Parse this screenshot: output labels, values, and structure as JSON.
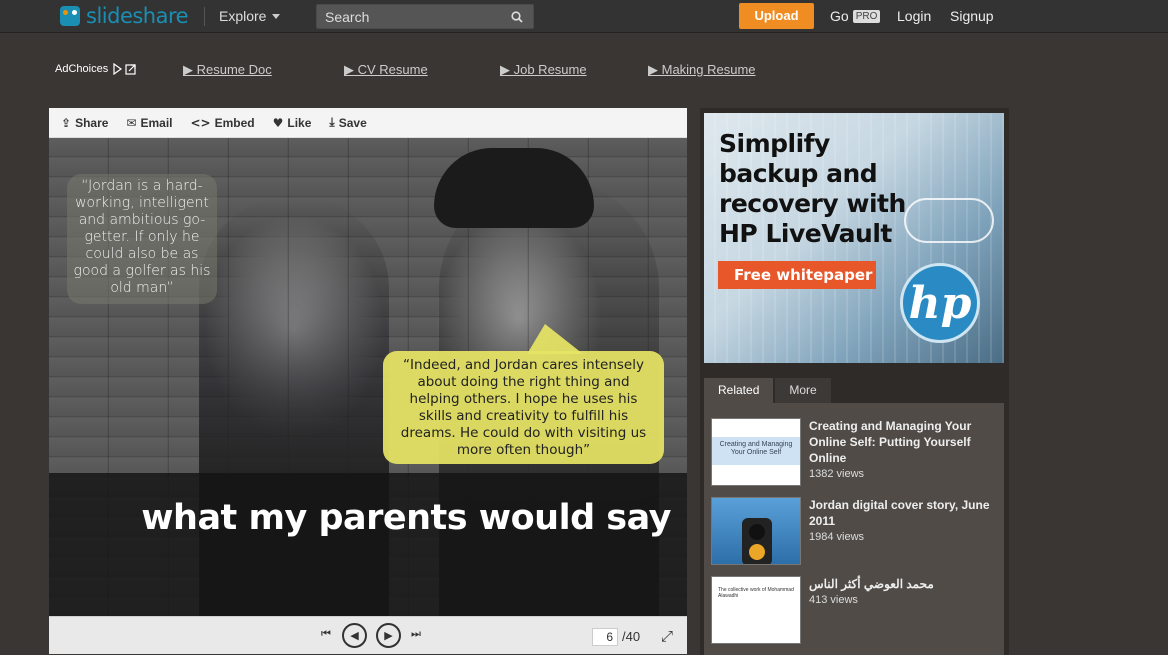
{
  "header": {
    "logo_text": "slideshare",
    "explore_label": "Explore",
    "search_placeholder": "Search",
    "upload_label": "Upload",
    "go_label": "Go",
    "pro_badge": "PRO",
    "login_label": "Login",
    "signup_label": "Signup"
  },
  "ads_row": {
    "adchoices_label": "AdChoices",
    "links": [
      "▶ Resume Doc",
      "▶ CV Resume",
      "▶ Job Resume",
      "▶ Making Resume"
    ]
  },
  "viewer": {
    "toolbar": {
      "share": "Share",
      "email": "Email",
      "embed": "Embed",
      "like": "Like",
      "save": "Save"
    },
    "slide": {
      "quote_left": "“Jordan is a hard-working, intelligent and ambitious go-getter. If only he could also be as good a golfer as his old man”",
      "quote_right": "“Indeed, and Jordan cares intensely about doing the right thing and helping others. I hope he uses his skills and creativity to fulfill his dreams. He could do with visiting us more often though”",
      "caption": "what my parents would say"
    },
    "controls": {
      "current_page": "6",
      "total_pages": "/40"
    }
  },
  "sidebar": {
    "ad": {
      "headline": "Simplify backup and recovery with HP LiveVault",
      "cta": "Free whitepaper",
      "brand": "hp"
    },
    "tabs": [
      "Related",
      "More"
    ],
    "related": [
      {
        "title": "Creating and Managing Your Online Self: Putting Yourself Online",
        "views": "1382 views",
        "thumb_text": "Creating and Managing Your Online Self"
      },
      {
        "title": "Jordan digital cover story, June 2011",
        "views": "1984 views"
      },
      {
        "title": "محمد العوضي أكثر الناس",
        "views": "413 views",
        "thumb_text": "The collective work of Mohammad Alawadhi"
      }
    ]
  },
  "colors": {
    "brand_blue": "#1a8fb3",
    "upload_orange": "#f08d22",
    "bubble_yellow": "#e6e464",
    "ad_cta": "#e8572a"
  }
}
